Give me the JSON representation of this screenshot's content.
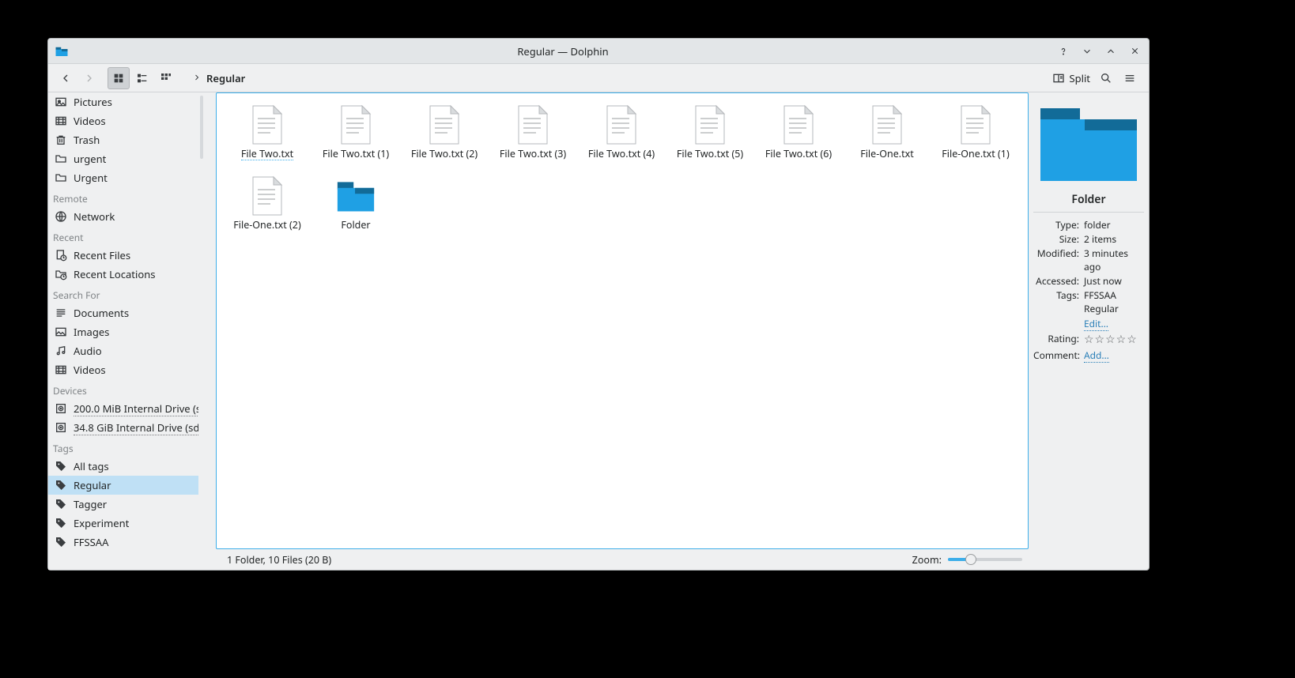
{
  "window": {
    "title": "Regular — Dolphin"
  },
  "toolbar": {
    "breadcrumb": [
      "Regular"
    ],
    "split_label": "Split"
  },
  "sidebar": {
    "top_items": [
      {
        "icon": "pictures-icon",
        "label": "Pictures"
      },
      {
        "icon": "videos-icon",
        "label": "Videos"
      },
      {
        "icon": "trash-icon",
        "label": "Trash"
      },
      {
        "icon": "folder-icon",
        "label": "urgent"
      },
      {
        "icon": "folder-icon",
        "label": "Urgent"
      }
    ],
    "remote_header": "Remote",
    "remote_items": [
      {
        "icon": "network-icon",
        "label": "Network"
      }
    ],
    "recent_header": "Recent",
    "recent_items": [
      {
        "icon": "recent-files-icon",
        "label": "Recent Files"
      },
      {
        "icon": "recent-places-icon",
        "label": "Recent Locations"
      }
    ],
    "search_header": "Search For",
    "search_items": [
      {
        "icon": "documents-icon",
        "label": "Documents"
      },
      {
        "icon": "images-icon",
        "label": "Images"
      },
      {
        "icon": "audio-icon",
        "label": "Audio"
      },
      {
        "icon": "videos-icon",
        "label": "Videos"
      }
    ],
    "devices_header": "Devices",
    "devices_items": [
      {
        "icon": "disk-icon",
        "label": "200.0 MiB Internal Drive (s…"
      },
      {
        "icon": "disk-icon",
        "label": "34.8 GiB Internal Drive (sd…"
      }
    ],
    "tags_header": "Tags",
    "tags_items": [
      {
        "icon": "tag-icon",
        "label": "All tags",
        "active": false
      },
      {
        "icon": "tag-icon",
        "label": "Regular",
        "active": true
      },
      {
        "icon": "tag-icon",
        "label": "Tagger",
        "active": false
      },
      {
        "icon": "tag-icon",
        "label": "Experiment",
        "active": false
      },
      {
        "icon": "tag-icon",
        "label": "FFSSAA",
        "active": false
      }
    ]
  },
  "files": [
    {
      "type": "txt",
      "label": "File Two.txt",
      "selected": true
    },
    {
      "type": "txt",
      "label": "File Two.txt (1)"
    },
    {
      "type": "txt",
      "label": "File Two.txt (2)"
    },
    {
      "type": "txt",
      "label": "File Two.txt (3)"
    },
    {
      "type": "txt",
      "label": "File Two.txt (4)"
    },
    {
      "type": "txt",
      "label": "File Two.txt (5)"
    },
    {
      "type": "txt",
      "label": "File Two.txt (6)"
    },
    {
      "type": "txt",
      "label": "File-One.txt"
    },
    {
      "type": "txt",
      "label": "File-One.txt (1)"
    },
    {
      "type": "txt",
      "label": "File-One.txt (2)"
    },
    {
      "type": "folder",
      "label": "Folder"
    }
  ],
  "info": {
    "name": "Folder",
    "rows": [
      {
        "k": "Type:",
        "v": "folder"
      },
      {
        "k": "Size:",
        "v": "2 items"
      },
      {
        "k": "Modified:",
        "v": "3 minutes ago"
      },
      {
        "k": "Accessed:",
        "v": "Just now"
      },
      {
        "k": "Tags:",
        "v": "FFSSAA  Regular"
      }
    ],
    "edit_label": "Edit…",
    "rating_label": "Rating:",
    "rating_value": 0,
    "comment_label": "Comment:",
    "comment_link": "Add…"
  },
  "statusbar": {
    "text": "1 Folder, 10 Files (20 B)",
    "zoom_label": "Zoom:"
  },
  "colors": {
    "accent": "#3daee9"
  }
}
